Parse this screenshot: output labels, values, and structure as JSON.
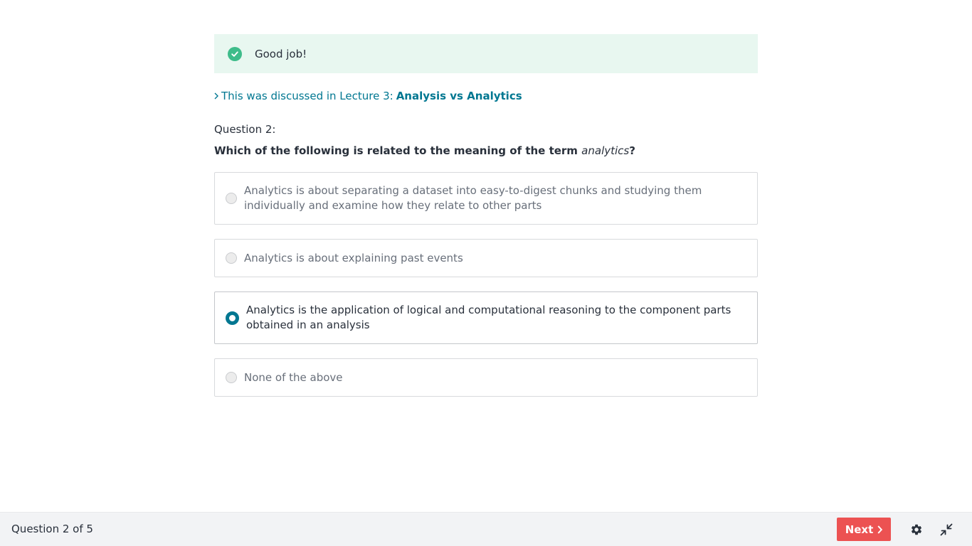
{
  "feedback": {
    "icon": "check-circle-icon",
    "text": "Good job!",
    "color": "#3ebc8a",
    "background": "#e8f7f0"
  },
  "lecture_ref": {
    "prefix": "This was discussed in Lecture 3:",
    "title": "Analysis vs Analytics",
    "color": "#007791"
  },
  "question": {
    "label": "Question 2:",
    "text_before": "Which of the following is related to the meaning of the term ",
    "text_term": "analytics",
    "text_after": "?"
  },
  "options": [
    {
      "text": "Analytics is about separating a dataset into easy-to-digest chunks and studying them individually and examine how they relate to other parts",
      "selected": false
    },
    {
      "text": "Analytics is about explaining past events",
      "selected": false
    },
    {
      "text": "Analytics is the application of logical and computational reasoning to the component parts obtained in an analysis",
      "selected": true
    },
    {
      "text": "None of the above",
      "selected": false
    }
  ],
  "footer": {
    "progress": "Question 2 of 5",
    "next_label": "Next",
    "next_color": "#ec5252",
    "settings_icon": "gear-icon",
    "collapse_icon": "collapse-icon"
  }
}
